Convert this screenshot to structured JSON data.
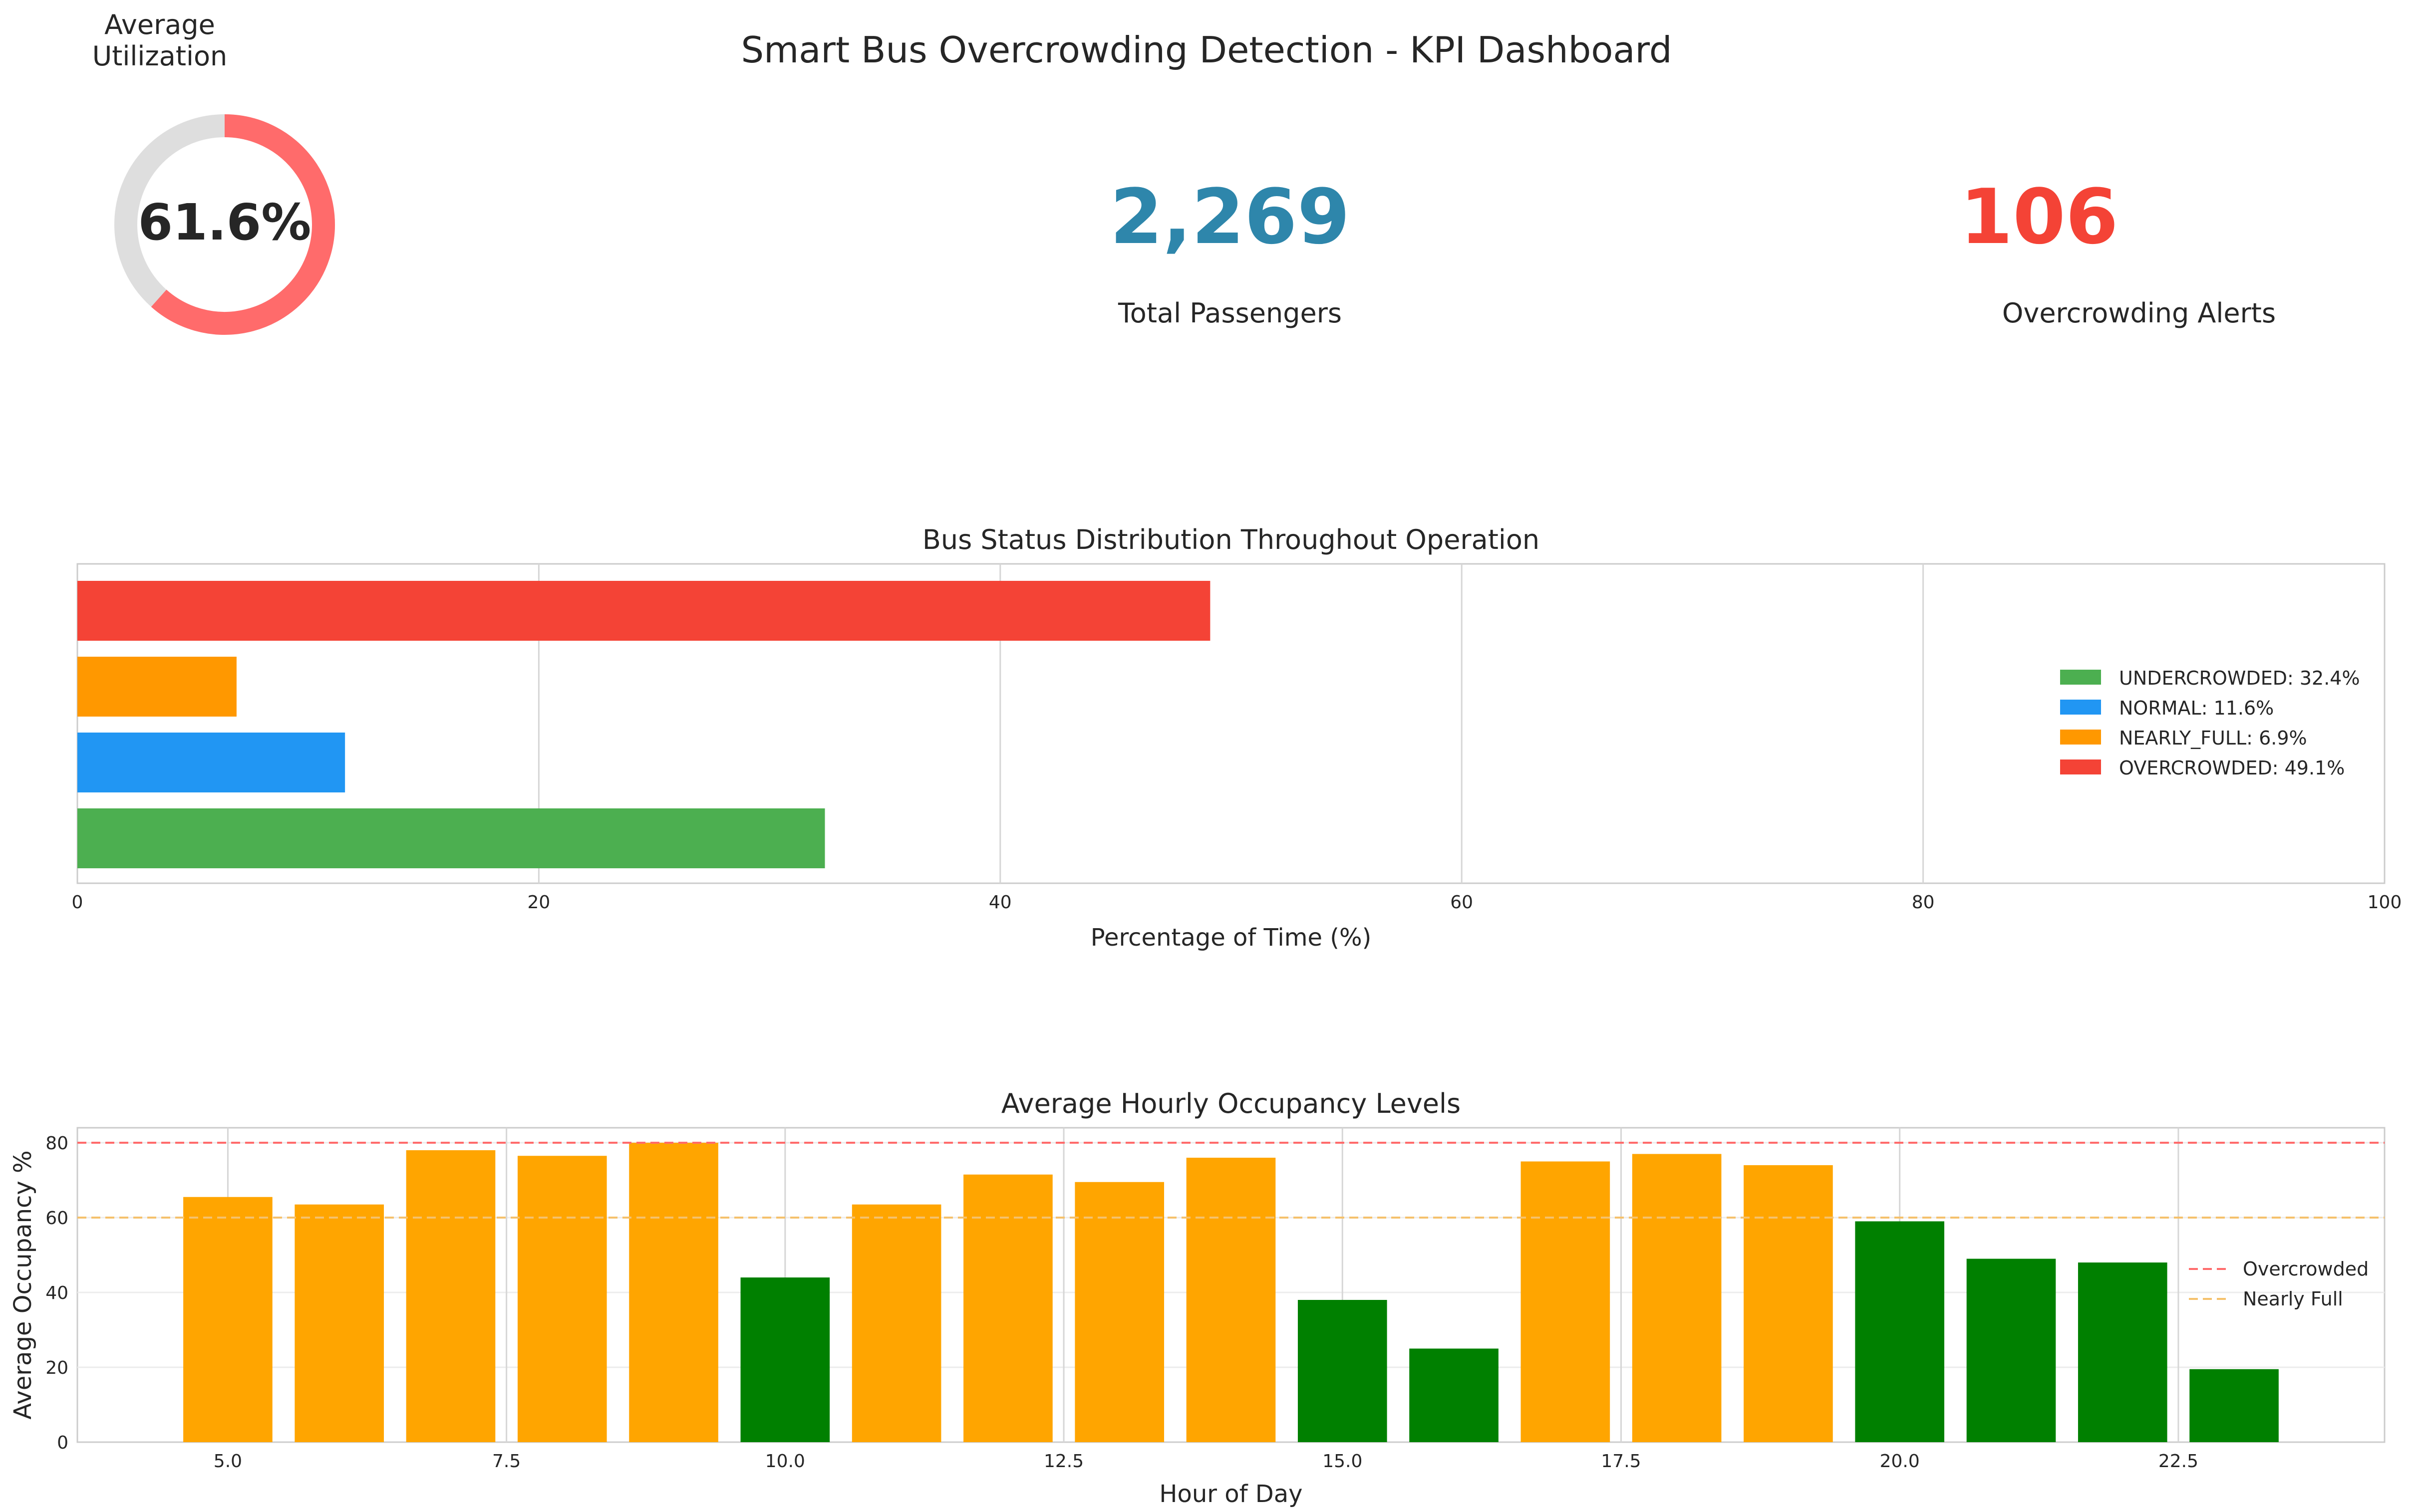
{
  "dashboard": {
    "title": "Smart Bus Overcrowding Detection - KPI Dashboard"
  },
  "kpis": {
    "utilization": {
      "title": "Average Utilization",
      "value_text": "61.6%",
      "fraction": 0.616,
      "color": "#ff6b6b",
      "track_color": "#dedede"
    },
    "passengers": {
      "value": "2,269",
      "label": "Total Passengers",
      "color": "#2e86ab"
    },
    "alerts": {
      "value": "106",
      "label": "Overcrowding Alerts",
      "color": "#f44336"
    }
  },
  "chart_data": [
    {
      "type": "bar",
      "orientation": "horizontal",
      "title": "Bus Status Distribution Throughout Operation",
      "xlabel": "Percentage of Time (%)",
      "ylabel": "",
      "xlim": [
        0,
        100
      ],
      "xticks": [
        0,
        20,
        40,
        60,
        80,
        100
      ],
      "categories": [
        "UNDERCROWDED",
        "NORMAL",
        "NEARLY_FULL",
        "OVERCROWDED"
      ],
      "values": [
        32.4,
        11.6,
        6.9,
        49.1
      ],
      "colors": [
        "#4caf50",
        "#2196f3",
        "#ff9800",
        "#f44336"
      ],
      "legend": {
        "position": "center-right",
        "entries": [
          "UNDERCROWDED: 32.4%",
          "NORMAL: 11.6%",
          "NEARLY_FULL: 6.9%",
          "OVERCROWDED: 49.1%"
        ]
      },
      "grid": true
    },
    {
      "type": "bar",
      "title": "Average Hourly Occupancy Levels",
      "xlabel": "Hour of Day",
      "ylabel": "Average Occupancy %",
      "xlim": [
        3.65,
        24.35
      ],
      "ylim": [
        0,
        84
      ],
      "xticks": [
        "5.0",
        "7.5",
        "10.0",
        "12.5",
        "15.0",
        "17.5",
        "20.0",
        "22.5"
      ],
      "yticks": [
        0,
        20,
        40,
        60,
        80
      ],
      "x": [
        5,
        6,
        7,
        8,
        9,
        10,
        11,
        12,
        13,
        14,
        15,
        16,
        17,
        18,
        19,
        20,
        21,
        22,
        23
      ],
      "values": [
        65.5,
        63.5,
        78,
        76.5,
        80,
        44,
        63.5,
        71.5,
        69.5,
        76,
        38,
        25,
        75,
        77,
        74,
        59,
        49,
        48,
        19.5
      ],
      "bar_colors": [
        "#ffa500",
        "#ffa500",
        "#ffa500",
        "#ffa500",
        "#ffa500",
        "#008000",
        "#ffa500",
        "#ffa500",
        "#ffa500",
        "#ffa500",
        "#008000",
        "#008000",
        "#ffa500",
        "#ffa500",
        "#ffa500",
        "#008000",
        "#008000",
        "#008000",
        "#008000"
      ],
      "thresholds": [
        {
          "label": "Overcrowded",
          "value": 80,
          "color": "#ff6b6b"
        },
        {
          "label": "Nearly Full",
          "value": 60,
          "color": "#f5c16c"
        }
      ],
      "legend": {
        "position": "center-right"
      },
      "grid": true
    }
  ]
}
